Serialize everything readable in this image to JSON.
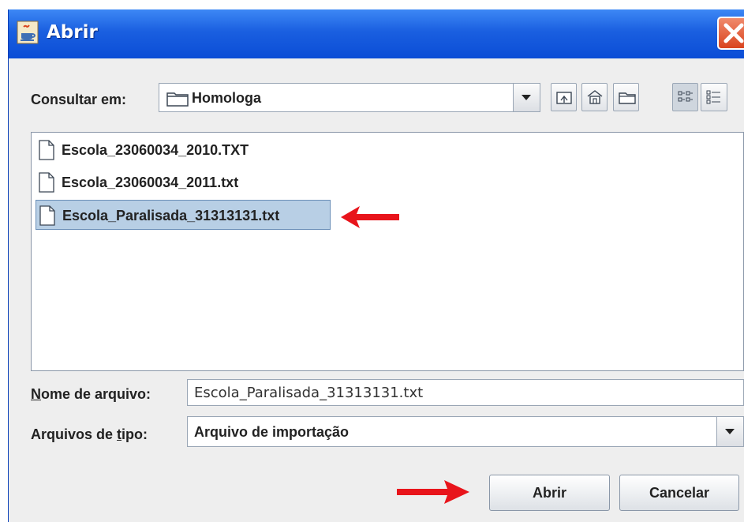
{
  "window": {
    "title": "Abrir",
    "title_color": "#ffffff",
    "titlebar_color": "#1a5fe0",
    "close_color": "#d9441f"
  },
  "look_in": {
    "label": "Consultar em:",
    "value": "Homologa"
  },
  "toolbar": {
    "icons": [
      "up-folder-icon",
      "home-icon",
      "new-folder-icon",
      "list-view-icon",
      "details-view-icon"
    ]
  },
  "files": [
    {
      "name": "Escola_23060034_2010.TXT",
      "selected": false
    },
    {
      "name": "Escola_23060034_2011.txt",
      "selected": false
    },
    {
      "name": "Escola_Paralisada_31313131.txt",
      "selected": true
    }
  ],
  "filename": {
    "label_prefix": "N",
    "label_rest": "ome de arquivo:",
    "value": "Escola_Paralisada_31313131.txt"
  },
  "filetype": {
    "label_prefix": "Arquivos de ",
    "label_mnemonic": "t",
    "label_rest": "ipo:",
    "value": "Arquivo de importação"
  },
  "buttons": {
    "open": "Abrir",
    "cancel": "Cancelar"
  },
  "annotation_color": "#e8141b"
}
